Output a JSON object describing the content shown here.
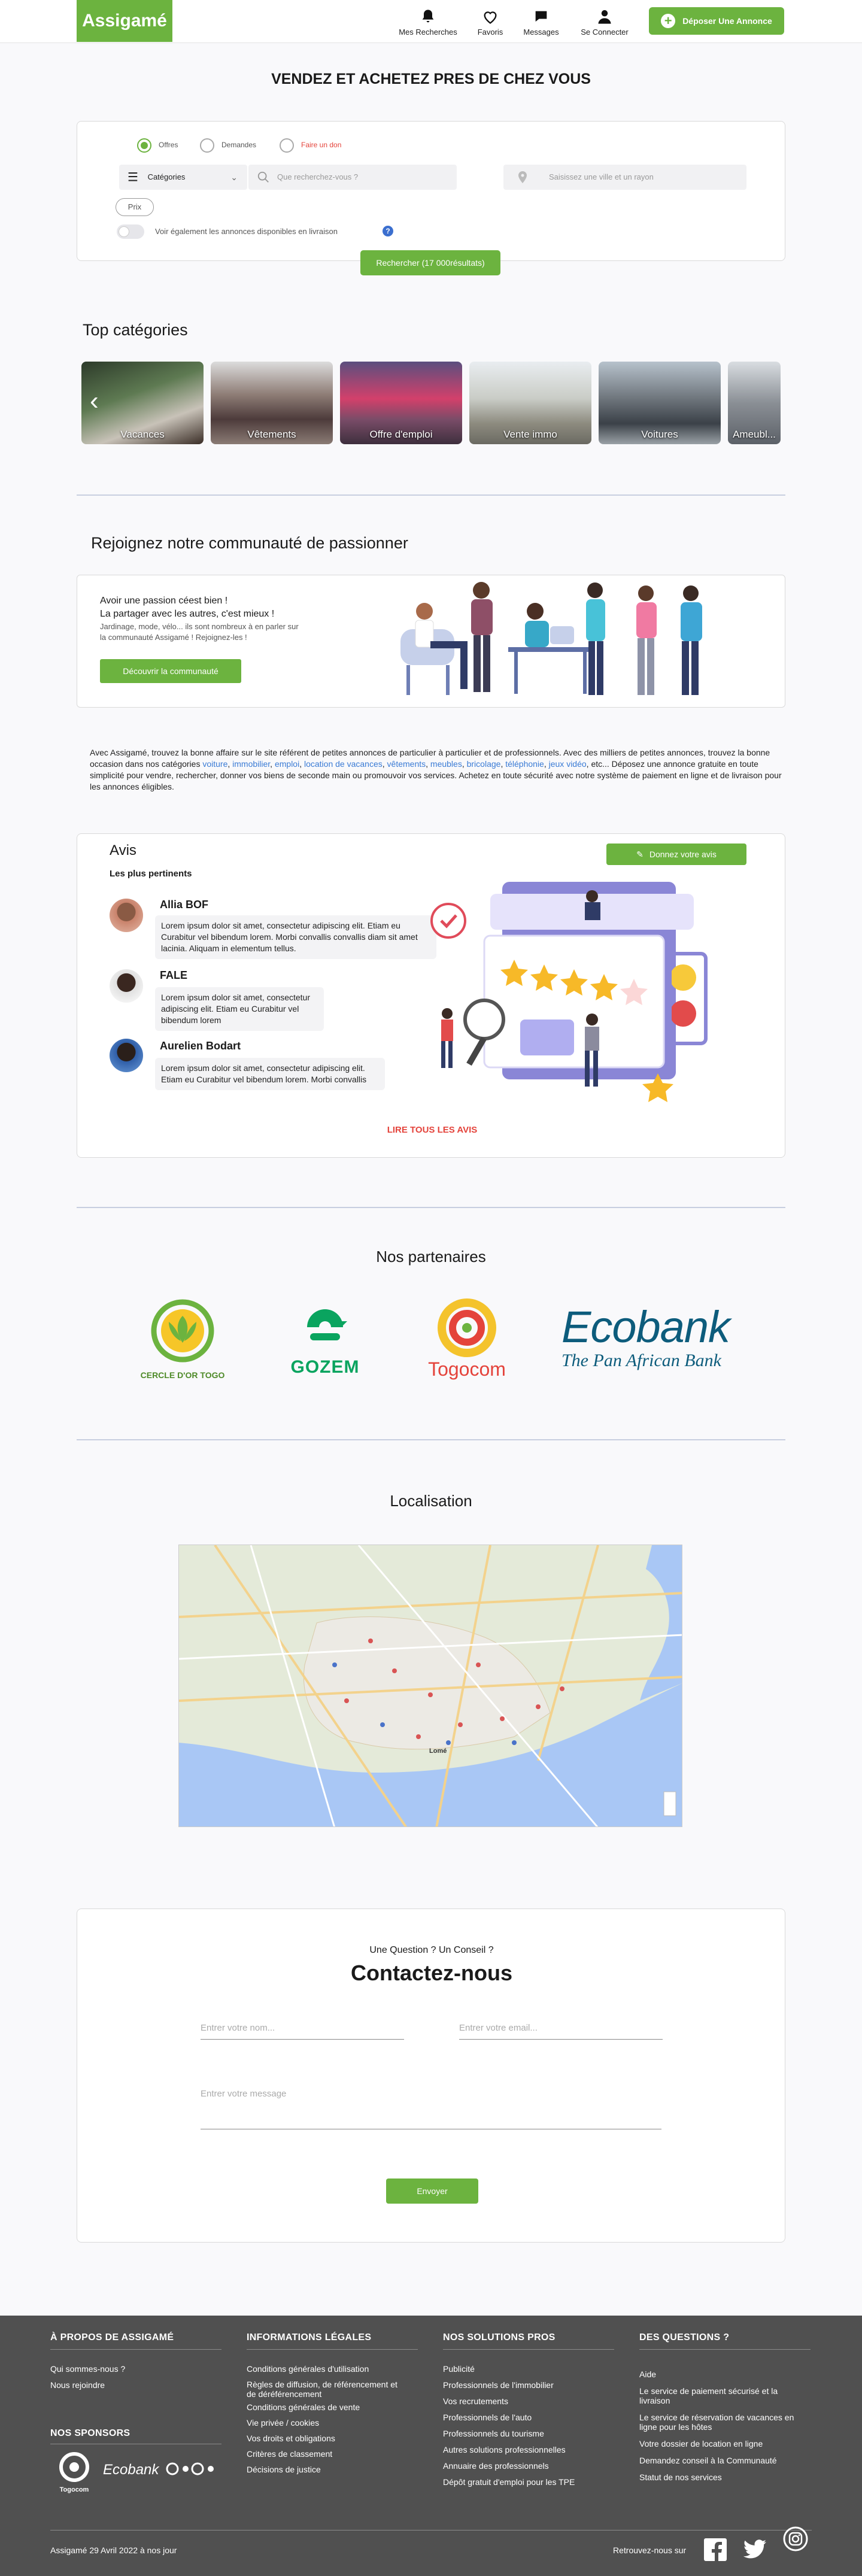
{
  "header": {
    "logo": "Assigamé",
    "nav": [
      {
        "label": "Mes Recherches",
        "icon": "bell-icon"
      },
      {
        "label": "Favoris",
        "icon": "heart-icon"
      },
      {
        "label": "Messages",
        "icon": "chat-icon"
      },
      {
        "label": "Se Connecter",
        "icon": "user-icon"
      }
    ],
    "deposit_label": "Déposer Une Annonce"
  },
  "hero": {
    "title": "VENDEZ ET ACHETEZ PRES DE CHEZ VOUS"
  },
  "search": {
    "radios": [
      {
        "label": "Offres",
        "selected": true
      },
      {
        "label": "Demandes",
        "selected": false
      },
      {
        "label": "Faire un don",
        "selected": false
      }
    ],
    "category_label": "Catégories",
    "query_placeholder": "Que recherchez-vous ?",
    "location_placeholder": "Saisissez une ville et un rayon",
    "price_label": "Prix",
    "delivery_label": "Voir également les annonces disponibles en livraison",
    "help_icon": "?",
    "submit_label": "Rechercher (17 000résultats)"
  },
  "categories": {
    "title": "Top catégories",
    "items": [
      {
        "label": "Vacances"
      },
      {
        "label": "Vêtements"
      },
      {
        "label": "Offre d'emploi"
      },
      {
        "label": "Vente immo"
      },
      {
        "label": "Voitures"
      },
      {
        "label": "Ameubl..."
      }
    ],
    "prev_icon": "‹",
    "next_icon": "›"
  },
  "community": {
    "title": "Rejoignez notre communauté de passionner",
    "line1": "Avoir une passion céest bien !",
    "line2": "La partager avec les autres, c'est mieux !",
    "line3": "Jardinage, mode, vélo... ils sont nombreux à en parler sur",
    "line4": "la communauté Assigamé ! Rejoignez-les !",
    "button": "Découvrir la communauté"
  },
  "about": {
    "text_before": "Avec Assigamé, trouvez la bonne affaire sur le site référent de petites annonces de particulier à particulier et de professionnels. Avec des milliers de petites annonces, trouvez la bonne occasion dans nos catégories ",
    "links": [
      "voiture",
      "immobilier",
      "emploi",
      "location de vacances",
      "vêtements",
      "meubles",
      "bricolage",
      "téléphonie",
      "jeux vidéo"
    ],
    "text_after": ", etc... Déposez une annonce gratuite en toute simplicité pour vendre, rechercher, donner vos biens de seconde main ou promouvoir vos services. Achetez en toute sécurité avec notre système de paiement en ligne et de livraison pour les annonces éligibles."
  },
  "reviews": {
    "title": "Avis",
    "subtitle": "Les plus pertinents",
    "give_button": "Donnez votre avis",
    "all_link": "LIRE TOUS LES AVIS",
    "items": [
      {
        "name": "Allia BOF",
        "text": "Lorem ipsum dolor sit amet, consectetur adipiscing elit. Etiam eu Curabitur vel bibendum lorem. Morbi convallis convallis diam sit amet lacinia. Aliquam in elementum tellus."
      },
      {
        "name": "FALE",
        "text": "Lorem ipsum dolor sit amet, consectetur adipiscing elit. Etiam eu Curabitur vel bibendum lorem"
      },
      {
        "name": "Aurelien Bodart",
        "text": "Lorem ipsum dolor sit amet, consectetur adipiscing elit. Etiam eu Curabitur vel bibendum lorem. Morbi convallis"
      }
    ]
  },
  "partners": {
    "title": "Nos partenaires",
    "items": [
      {
        "name": "CERCLE D'OR TOGO"
      },
      {
        "name": "GOZEM"
      },
      {
        "name": "Togocom"
      },
      {
        "name": "Ecobank",
        "tagline": "The Pan African Bank"
      }
    ]
  },
  "location": {
    "title": "Localisation",
    "map_place": "Lomé"
  },
  "contact": {
    "pre_title": "Une Question ? Un Conseil ?",
    "title": "Contactez-nous",
    "name_placeholder": "Entrer votre nom...",
    "email_placeholder": "Entrer votre email...",
    "message_placeholder": "Entrer votre message",
    "send_label": "Envoyer"
  },
  "footer": {
    "columns": [
      {
        "title": "À PROPOS DE ASSIGAMÉ",
        "items": [
          "Qui sommes-nous ?",
          "Nous rejoindre"
        ]
      },
      {
        "title": "INFORMATIONS LÉGALES",
        "items": [
          "Conditions générales d'utilisation",
          "Règles de diffusion, de référencement et",
          "de déréférencement",
          "Conditions générales de vente",
          "Vie privée / cookies",
          "Vos droits et obligations",
          "Critères de classement",
          "Décisions de justice"
        ]
      },
      {
        "title": "NOS SOLUTIONS PROS",
        "items": [
          "Publicité",
          "Professionnels de l'immobilier",
          "Vos recrutements",
          "Professionnels de l'auto",
          "Professionnels du tourisme",
          "Autres solutions professionnelles",
          "Annuaire des professionnels",
          "Dépôt gratuit d'emploi pour les TPE"
        ]
      },
      {
        "title": "DES QUESTIONS ?",
        "items": [
          "Aide",
          "Le service de paiement sécurisé et la",
          "livraison",
          "Le service de réservation de vacances en",
          "ligne pour les hôtes",
          "Votre dossier de location en ligne",
          "Demandez conseil à la Communauté",
          "Statut de nos services"
        ]
      }
    ],
    "sponsors_title": "NOS SPONSORS",
    "sponsors": [
      "Togocom",
      "Ecobank"
    ],
    "copyright": "Assigamé 29 Avril 2022 à nos jour",
    "follow_label": "Retrouvez-nous sur"
  }
}
